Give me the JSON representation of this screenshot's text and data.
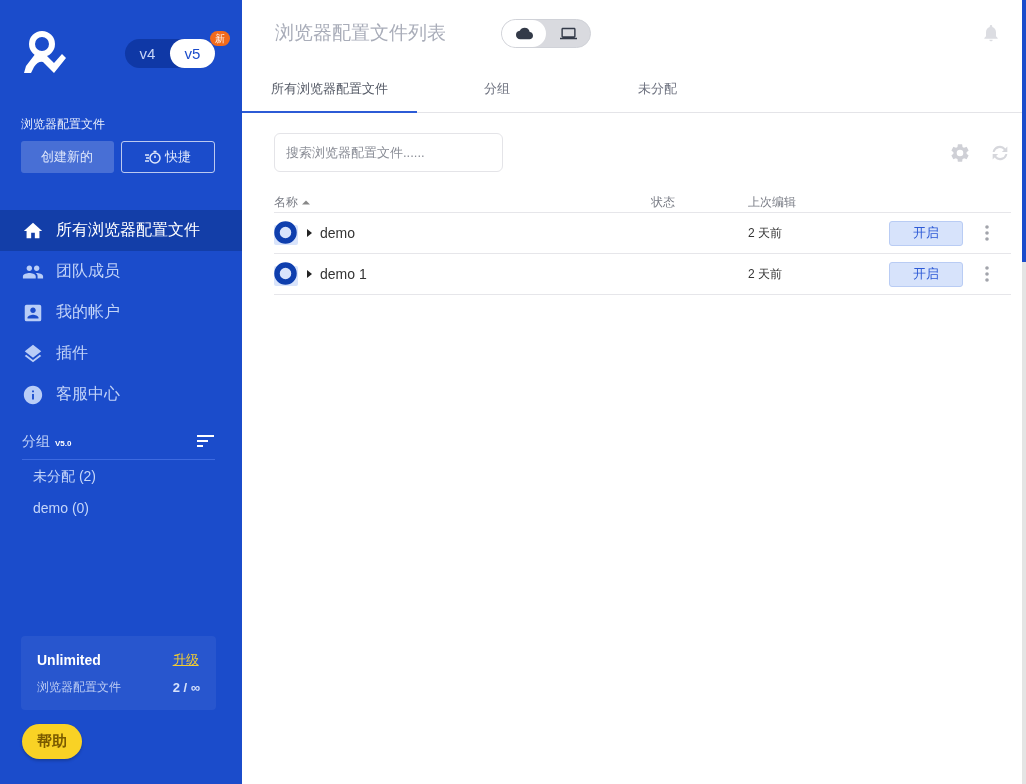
{
  "sidebar": {
    "versions": [
      {
        "label": "v4",
        "selected": false
      },
      {
        "label": "v5",
        "selected": true,
        "badge": "新"
      }
    ],
    "section_label": "浏览器配置文件",
    "buttons": [
      {
        "label": "创建新的",
        "kind": "filled"
      },
      {
        "label": "快捷",
        "kind": "outline"
      }
    ],
    "nav": [
      {
        "label": "所有浏览器配置文件",
        "kind": "home",
        "selected": true
      },
      {
        "label": "团队成员",
        "kind": "people",
        "selected": false
      },
      {
        "label": "我的帐户",
        "kind": "account",
        "selected": false
      },
      {
        "label": "插件",
        "kind": "layers",
        "selected": false
      },
      {
        "label": "客服中心",
        "kind": "info",
        "selected": false
      }
    ],
    "groups": {
      "title": "分组",
      "version": "V5.0",
      "items": [
        "未分配 (2)",
        "demo (0)"
      ]
    },
    "plan": {
      "name": "Unlimited",
      "link": "升级",
      "label": "浏览器配置文件",
      "count": "2 / ∞"
    },
    "help": "帮助"
  },
  "header": {
    "title": "浏览器配置文件列表",
    "storage": [
      {
        "kind": "cloud",
        "selected": true
      },
      {
        "kind": "laptop",
        "selected": false
      }
    ]
  },
  "tabs": [
    {
      "label": "所有浏览器配置文件",
      "selected": true
    },
    {
      "label": "分组",
      "selected": false
    },
    {
      "label": "未分配",
      "selected": false
    }
  ],
  "search": {
    "placeholder": "搜索浏览器配置文件......"
  },
  "table": {
    "columns": [
      "名称",
      "状态",
      "上次编辑"
    ],
    "rows": [
      {
        "name": "demo",
        "last_edited": "2 天前",
        "action": "开启"
      },
      {
        "name": "demo 1",
        "last_edited": "2 天前",
        "action": "开启"
      }
    ]
  }
}
